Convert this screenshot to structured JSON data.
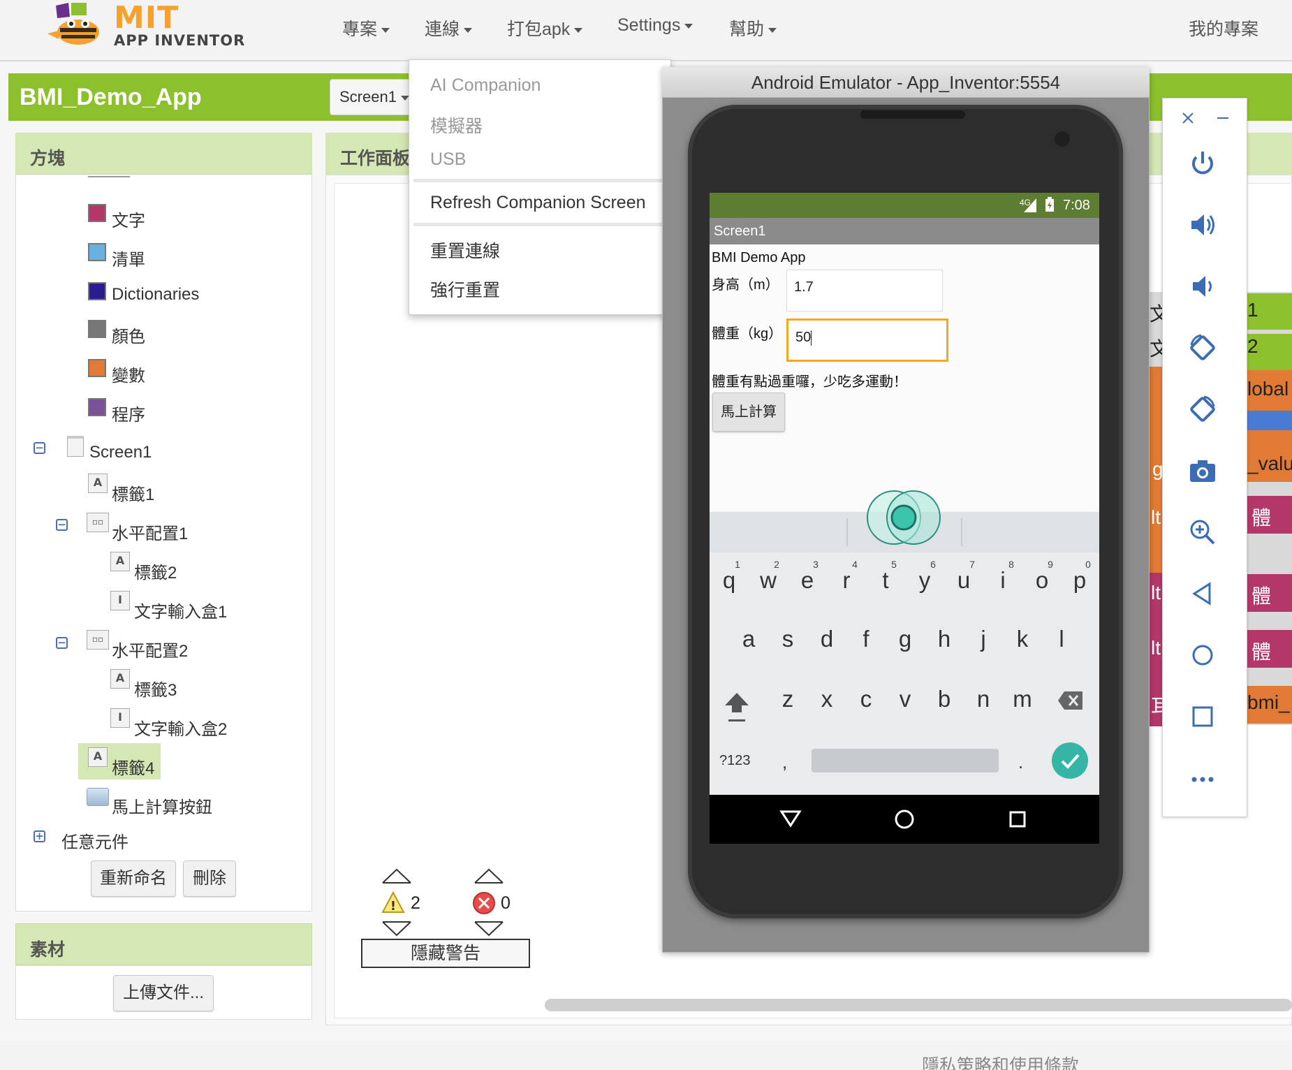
{
  "topbar": {
    "logo_main": "MIT",
    "logo_sub": "APP INVENTOR",
    "menus": [
      "專案",
      "連線",
      "打包apk",
      "Settings",
      "幫助"
    ],
    "my_projects": "我的專案"
  },
  "project": {
    "name": "BMI_Demo_App",
    "screen_select": "Screen1"
  },
  "blocks_panel": {
    "title": "方塊",
    "builtin": [
      {
        "label": "文字",
        "color": "#b3386a"
      },
      {
        "label": "清單",
        "color": "#69b1e0"
      },
      {
        "label": "Dictionaries",
        "color": "#2b1d8f"
      },
      {
        "label": "顏色",
        "color": "#777777"
      },
      {
        "label": "變數",
        "color": "#e07a34"
      },
      {
        "label": "程序",
        "color": "#7b5299"
      }
    ],
    "tree": {
      "screen": "Screen1",
      "label1": "標籤1",
      "hz1": "水平配置1",
      "label2": "標籤2",
      "textbox1": "文字輸入盒1",
      "hz2": "水平配置2",
      "label3": "標籤3",
      "textbox2": "文字輸入盒2",
      "label4": "標籤4",
      "button": "馬上計算按鈕",
      "any": "任意元件"
    },
    "rename_button": "重新命名",
    "delete_button": "刪除"
  },
  "assets_panel": {
    "title": "素材",
    "upload_button": "上傳文件..."
  },
  "workspace": {
    "title": "工作面板",
    "warning_count": "2",
    "error_count": "0",
    "hide_warnings_button": "隱藏警告"
  },
  "connect_menu": {
    "items": [
      "AI Companion",
      "模擬器",
      "USB"
    ],
    "refresh": "Refresh Companion Screen",
    "reset": "重置連線",
    "hard_reset": "強行重置"
  },
  "emulator": {
    "title": "Android Emulator - App_Inventor:5554",
    "status_time": "7:08",
    "status_net": "4G",
    "app_title": "Screen1",
    "app_heading": "BMI Demo App",
    "height_label": "身高（m）",
    "height_value": "1.7",
    "weight_label": "體重（kg）",
    "weight_value": "50",
    "result_text": "體重有點過重囉，少吃多運動！",
    "calc_button": "馬上計算",
    "keyboard": {
      "row1": [
        "q",
        "w",
        "e",
        "r",
        "t",
        "y",
        "u",
        "i",
        "o",
        "p"
      ],
      "row1_hints": [
        "1",
        "2",
        "3",
        "4",
        "5",
        "6",
        "7",
        "8",
        "9",
        "0"
      ],
      "row2": [
        "a",
        "s",
        "d",
        "f",
        "g",
        "h",
        "j",
        "k",
        "l"
      ],
      "row3": [
        "z",
        "x",
        "c",
        "v",
        "b",
        "n",
        "m"
      ],
      "symbols_key": "?123",
      "comma": ",",
      "period": "."
    }
  },
  "side_toolbar": {
    "icons": [
      "power-icon",
      "volume-up-icon",
      "volume-down-icon",
      "rotate-left-icon",
      "rotate-right-icon",
      "camera-icon",
      "zoom-icon",
      "back-icon",
      "home-icon",
      "overview-icon",
      "more-icon"
    ]
  },
  "peek": {
    "left_chars": [
      "文",
      "文",
      "g",
      "lt",
      "lt",
      "lt",
      "耳"
    ],
    "right_texts": [
      "1",
      "2",
      "lobal",
      "_valu",
      "體",
      "體",
      "體",
      "bmi_"
    ]
  },
  "footer": {
    "privacy": "隱私策略和使用條款"
  },
  "colors": {
    "accent_green": "#8dc02d",
    "panel_head": "#d5e7b3",
    "emulator_status": "#5d7d32",
    "focus_orange": "#f5a623",
    "keyboard_enter": "#35b5a5"
  }
}
